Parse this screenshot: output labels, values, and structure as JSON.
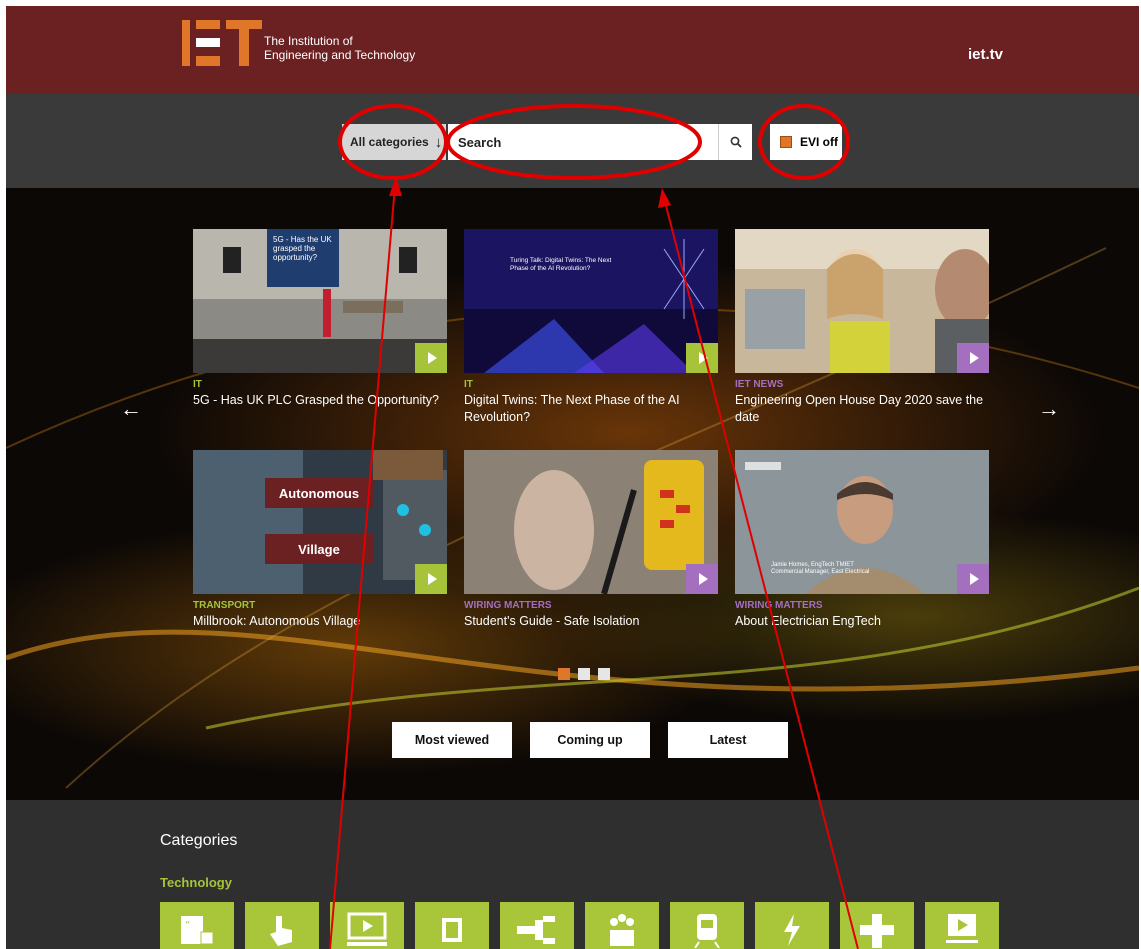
{
  "header": {
    "logo_text_line1": "The Institution of",
    "logo_text_line2": "Engineering and Technology",
    "site_link": "iet.tv"
  },
  "search": {
    "category_label": "All categories",
    "placeholder": "Search",
    "evi_label": "EVI off"
  },
  "carousel": {
    "cards": [
      {
        "category": "IT",
        "category_color": "#a6c33a",
        "title": "5G - Has UK PLC Grasped the Opportunity?",
        "play_color": "#a6c33a"
      },
      {
        "category": "IT",
        "category_color": "#a6c33a",
        "title": "Digital Twins: The Next Phase of the AI Revolution?",
        "play_color": "#a6c33a"
      },
      {
        "category": "IET NEWS",
        "category_color": "#a46fbf",
        "title": "Engineering Open House Day 2020 save the date",
        "play_color": "#a46fbf"
      },
      {
        "category": "TRANSPORT",
        "category_color": "#a6c33a",
        "title": "Millbrook: Autonomous Village",
        "play_color": "#a6c33a"
      },
      {
        "category": "WIRING MATTERS",
        "category_color": "#a46fbf",
        "title": "Student's Guide - Safe Isolation",
        "play_color": "#a46fbf"
      },
      {
        "category": "WIRING MATTERS",
        "category_color": "#a46fbf",
        "title": "About Electrician EngTech",
        "play_color": "#a46fbf"
      }
    ],
    "thumb_texts": {
      "t1_overlay": "5G - Has the UK grasped the opportunity?",
      "t2_heading": "Turing Talk: Digital Twins: The Next Phase of the AI Revolution?",
      "t4_word1": "Autonomous",
      "t4_word2": "Village",
      "t6_caption_name": "Jamie Homes, EngTech TMIET",
      "t6_caption_role": "Commercial Manager, East Electrical"
    },
    "active_page": 1,
    "page_count": 3
  },
  "filters": {
    "most_viewed": "Most viewed",
    "coming_up": "Coming up",
    "latest": "Latest"
  },
  "categories": {
    "heading": "Categories",
    "sub_heading": "Technology",
    "icons": [
      "quote-board-icon",
      "touch-hand-icon",
      "video-screen-icon",
      "chip-icon",
      "cable-connector-icon",
      "group-icon",
      "train-icon",
      "lightning-icon",
      "plus-icon",
      "presentation-icon"
    ]
  },
  "colors": {
    "header_bg": "#6b2022",
    "accent_orange": "#e0762a",
    "accent_green": "#a6c33a",
    "accent_purple": "#a46fbf",
    "annotation_red": "#e00000"
  }
}
